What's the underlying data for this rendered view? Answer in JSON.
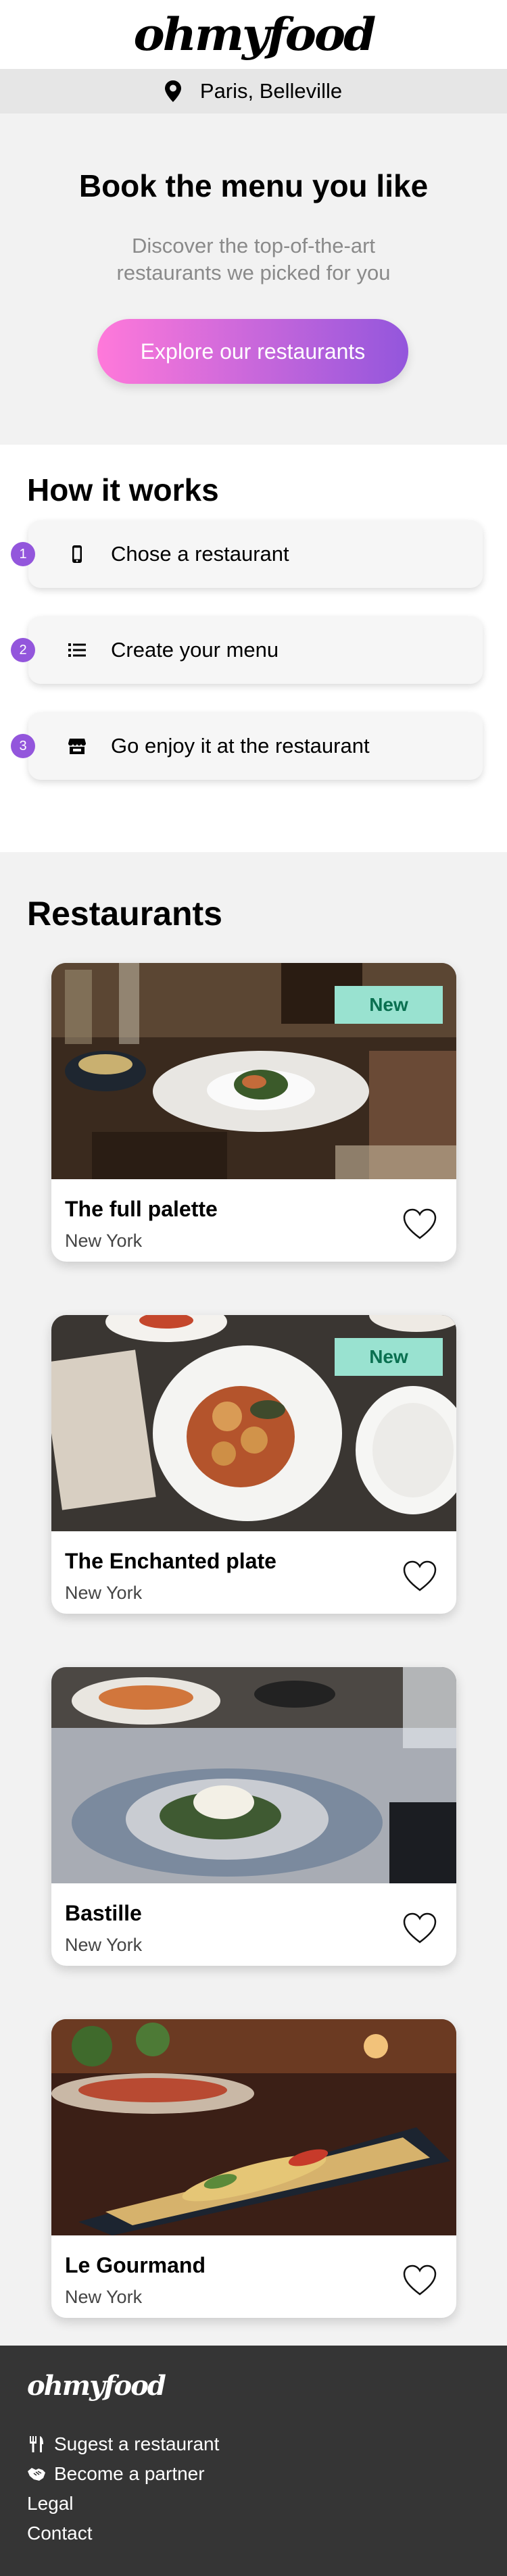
{
  "header": {
    "logo": "ohmyfood"
  },
  "location": {
    "icon": "map-pin-icon",
    "text": "Paris, Belleville"
  },
  "hero": {
    "title": "Book the menu you like",
    "subtitle_line1": "Discover the top-of-the-art",
    "subtitle_line2": "restaurants we picked for you",
    "cta_label": "Explore our restaurants",
    "cta_gradient": [
      "#ff79da",
      "#9356dc"
    ]
  },
  "how": {
    "title": "How it works",
    "steps": [
      {
        "number": "1",
        "icon": "mobile-phone-icon",
        "label": "Chose a restaurant"
      },
      {
        "number": "2",
        "icon": "list-icon",
        "label": "Create your menu"
      },
      {
        "number": "3",
        "icon": "store-icon",
        "label": "Go enjoy it at the restaurant"
      }
    ]
  },
  "restaurants": {
    "title": "Restaurants",
    "cards": [
      {
        "name": "The full palette",
        "city": "New York",
        "badge": "New",
        "favorite": false
      },
      {
        "name": "The Enchanted plate",
        "city": "New York",
        "badge": "New",
        "favorite": false
      },
      {
        "name": "Bastille",
        "city": "New York",
        "badge": "",
        "favorite": false
      },
      {
        "name": "Le Gourmand",
        "city": "New York",
        "badge": "",
        "favorite": false
      }
    ]
  },
  "footer": {
    "logo": "ohmyfood",
    "links": [
      {
        "icon": "utensils-icon",
        "label": "Sugest a restaurant"
      },
      {
        "icon": "handshake-icon",
        "label": "Become a partner"
      },
      {
        "icon": "",
        "label": "Legal"
      },
      {
        "icon": "",
        "label": "Contact"
      }
    ]
  },
  "colors": {
    "accent": "#9356dc",
    "badge_bg": "#99e2d0",
    "badge_text": "#0a7050",
    "footer_bg": "#353535"
  }
}
